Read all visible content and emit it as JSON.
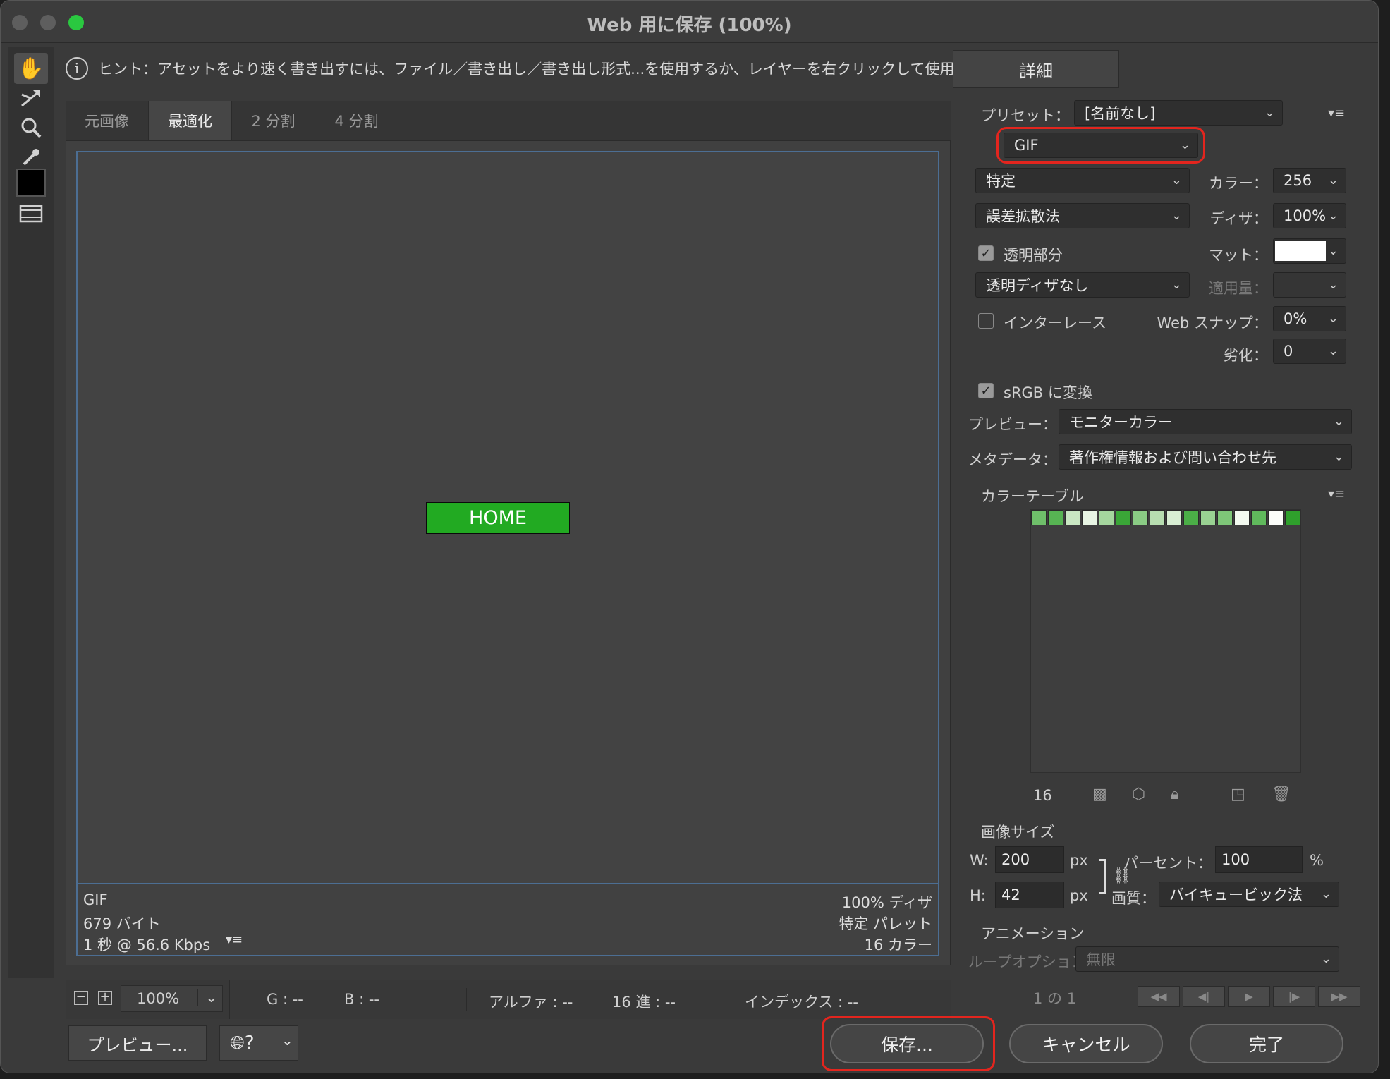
{
  "window": {
    "title": "Web 用に保存 (100%)"
  },
  "traffic_lights": {
    "close_color": "#5e5e5e",
    "minimize_color": "#5e5e5e",
    "zoom_color": "#2ac840"
  },
  "hint": {
    "icon": "info-icon",
    "text": "ヒント：アセットをより速く書き出すには、ファイル／書き出し／書き出し形式...を使用するか、レイヤーを右クリックして使用。"
  },
  "detail_button": "詳細",
  "tabs": [
    {
      "label": "元画像",
      "active": false
    },
    {
      "label": "最適化",
      "active": true
    },
    {
      "label": "2 分割",
      "active": false
    },
    {
      "label": "4 分割",
      "active": false
    }
  ],
  "preview": {
    "button_label": "HOME",
    "button_color": "#22aa22"
  },
  "info": {
    "left": [
      "GIF",
      "679 バイト",
      "1 秒 @ 56.6 Kbps"
    ],
    "right": [
      "100% ディザ",
      "特定 パレット",
      "16 カラー"
    ]
  },
  "bottom_bar": {
    "zoom": "100%",
    "g": "G : --",
    "b": "B : --",
    "alpha": "アルファ : --",
    "hex": "16 進 : --",
    "index": "インデックス : --"
  },
  "footer": {
    "preview": "プレビュー...",
    "save": "保存...",
    "cancel": "キャンセル",
    "done": "完了"
  },
  "settings": {
    "preset_label": "プリセット：",
    "preset_value": "[名前なし]",
    "format": "GIF",
    "reduction": "特定",
    "colors_label": "カラー：",
    "colors_value": "256",
    "dither_algo": "誤差拡散法",
    "dither_label": "ディザ：",
    "dither_value": "100%",
    "transparency_label": "透明部分",
    "transparency_checked": true,
    "matte_label": "マット：",
    "transparency_dither": "透明ディザなし",
    "amount_label": "適用量：",
    "interlace_label": "インターレース",
    "interlace_checked": false,
    "websnap_label": "Web スナップ：",
    "websnap_value": "0%",
    "lossy_label": "劣化：",
    "lossy_value": "0",
    "srgb_label": "sRGB に変換",
    "srgb_checked": true,
    "preview_label": "プレビュー：",
    "preview_value": "モニターカラー",
    "metadata_label": "メタデータ：",
    "metadata_value": "著作権情報および問い合わせ先"
  },
  "color_table": {
    "title": "カラーテーブル",
    "count": "16",
    "swatches": [
      "#6fbf6a",
      "#57b453",
      "#c9e7c2",
      "#e8f5e4",
      "#a5d69e",
      "#3aa637",
      "#8acb84",
      "#b7ddb0",
      "#d8eed3",
      "#4bae47",
      "#99d192",
      "#7ec678",
      "#f2f9ef",
      "#60b95c",
      "#fbfdf9",
      "#2fa02c"
    ]
  },
  "image_size": {
    "title": "画像サイズ",
    "w_label": "W:",
    "w_value": "200",
    "h_label": "H:",
    "h_value": "42",
    "unit": "px",
    "percent_label": "パーセント：",
    "percent_value": "100",
    "percent_unit": "%",
    "quality_label": "画質：",
    "quality_value": "バイキュービック法"
  },
  "animation": {
    "title": "アニメーション",
    "loop_label": "ループオプション：",
    "loop_value": "無限",
    "frame": "1 の 1"
  }
}
